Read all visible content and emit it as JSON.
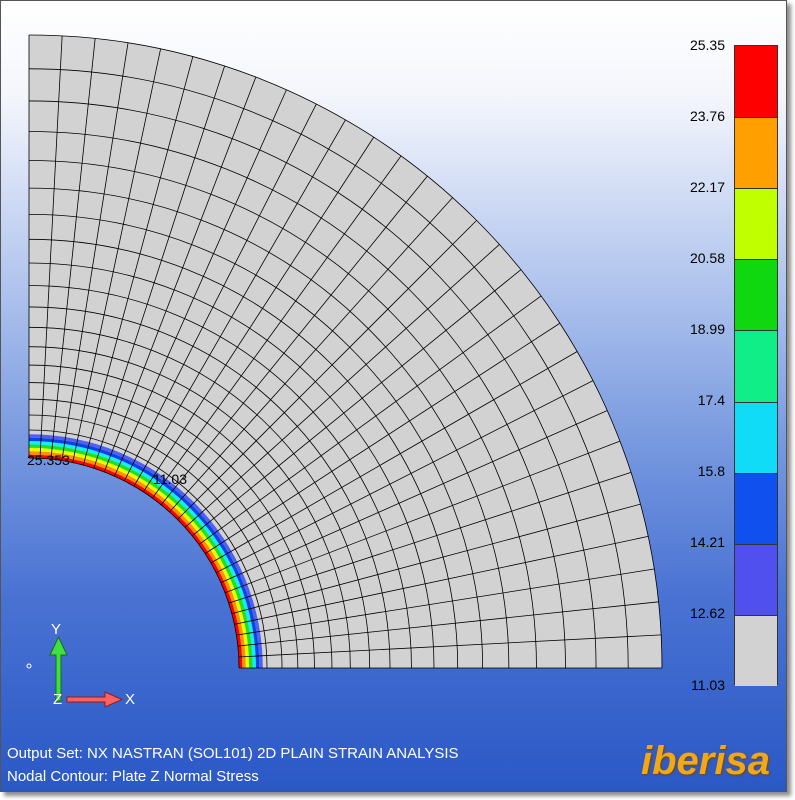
{
  "legend": {
    "values": [
      "25.35",
      "23.76",
      "22.17",
      "20.58",
      "18.99",
      "17.4",
      "15.8",
      "14.21",
      "12.62",
      "11.03"
    ],
    "colors": [
      "#ff0000",
      "#ffa000",
      "#c0ff00",
      "#10d810",
      "#10ee88",
      "#10dcf8",
      "#1050ee",
      "#5050ee",
      "#d2d2d2"
    ]
  },
  "contour_colors": {
    "mesh_fill": "#d2d2d2",
    "mesh_line": "#000000",
    "bands": [
      "#ff0000",
      "#ff9000",
      "#e8ff00",
      "#20e020",
      "#10f0f0",
      "#1040e8",
      "#5060ee"
    ]
  },
  "labels": {
    "max_node": "25.353",
    "min_node": "11.03"
  },
  "triad": {
    "y_label": "Y",
    "z_label": "Z",
    "x_label": "X",
    "y_color": "#40e040",
    "x_color": "#ff6060"
  },
  "info": {
    "output_set": "Output Set: NX NASTRAN (SOL101) 2D PLAIN STRAIN ANALYSIS",
    "contour": "Nodal Contour: Plate Z Normal Stress"
  },
  "brand": "iberisa"
}
